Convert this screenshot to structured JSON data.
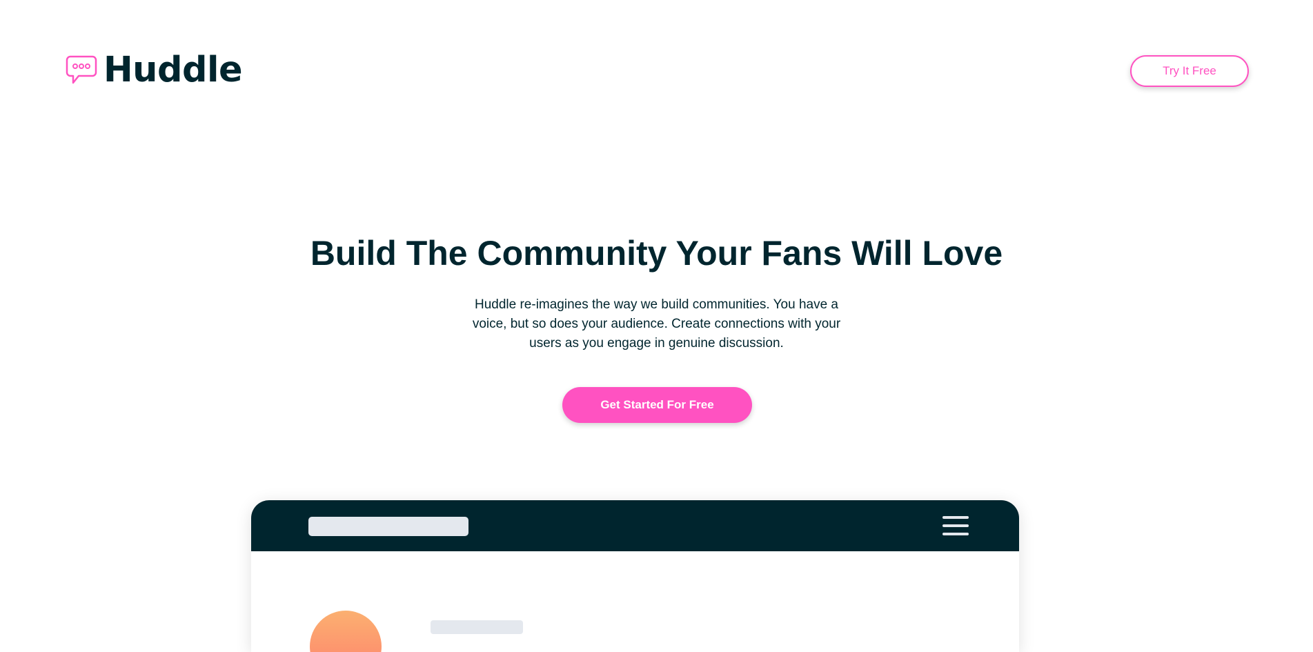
{
  "header": {
    "logo_text": "Huddle",
    "logo_icon": "chat-bubble-icon",
    "cta_label": "Try It Free"
  },
  "hero": {
    "title": "Build The Community Your Fans Will Love",
    "description": "Huddle re-imagines the way we build communities. You have a voice, but so does your audience. Create connections with your users as you engage in genuine discussion.",
    "cta_label": "Get Started For Free"
  },
  "mockup": {
    "menu_icon": "hamburger-menu-icon"
  },
  "colors": {
    "brand_pink": "#ff52c1",
    "dark_navy": "#00252e",
    "placeholder_gray": "#e4e8ee",
    "avatar_gradient_start": "#fbb070",
    "avatar_gradient_end": "#ff7f6d"
  }
}
